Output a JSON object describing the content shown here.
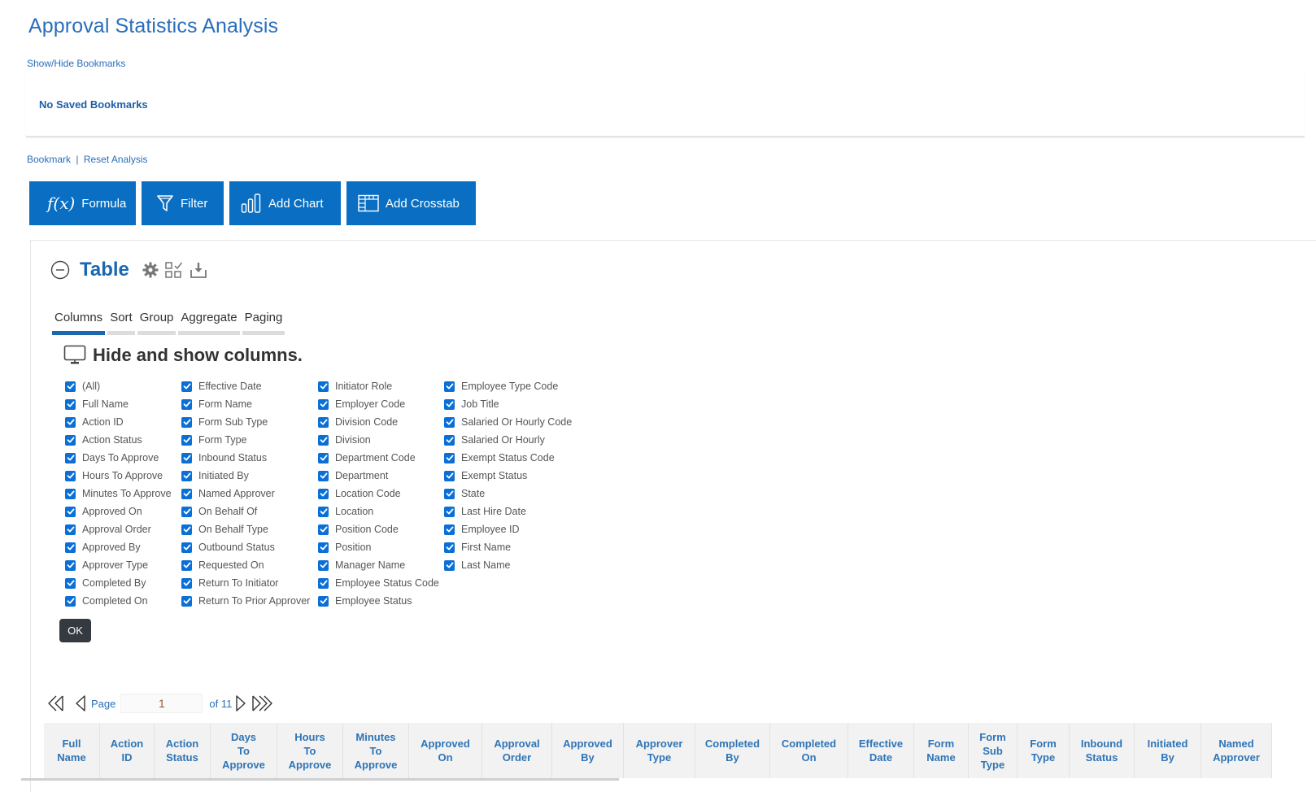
{
  "page": {
    "title": "Approval Statistics Analysis",
    "show_hide_bookmarks": "Show/Hide Bookmarks",
    "no_bookmarks": "No Saved Bookmarks",
    "bookmark_link": "Bookmark",
    "separator": "|",
    "reset_link": "Reset Analysis"
  },
  "toolbar": {
    "formula_icon": "f(x)",
    "formula": "Formula",
    "filter": "Filter",
    "add_chart": "Add Chart",
    "add_crosstab": "Add Crosstab"
  },
  "table_panel": {
    "title": "Table",
    "tabs": [
      {
        "label": "Columns",
        "active": true
      },
      {
        "label": "Sort",
        "active": false
      },
      {
        "label": "Group",
        "active": false
      },
      {
        "label": "Aggregate",
        "active": false
      },
      {
        "label": "Paging",
        "active": false
      }
    ],
    "columns_heading": "Hide and show columns.",
    "column_groups": [
      [
        "(All)",
        "Full Name",
        "Action ID",
        "Action Status",
        "Days To Approve",
        "Hours To Approve",
        "Minutes To Approve",
        "Approved On",
        "Approval Order",
        "Approved By",
        "Approver Type",
        "Completed By",
        "Completed On"
      ],
      [
        "Effective Date",
        "Form Name",
        "Form Sub Type",
        "Form Type",
        "Inbound Status",
        "Initiated By",
        "Named Approver",
        "On Behalf Of",
        "On Behalf Type",
        "Outbound Status",
        "Requested On",
        "Return To Initiator",
        "Return To Prior Approver"
      ],
      [
        "Initiator Role",
        "Employer Code",
        "Division Code",
        "Division",
        "Department Code",
        "Department",
        "Location Code",
        "Location",
        "Position Code",
        "Position",
        "Manager Name",
        "Employee Status Code",
        "Employee Status"
      ],
      [
        "Employee Type Code",
        "Job Title",
        "Salaried Or Hourly Code",
        "Salaried Or Hourly",
        "Exempt Status Code",
        "Exempt Status",
        "State",
        "Last Hire Date",
        "Employee ID",
        "First Name",
        "Last Name"
      ]
    ],
    "all_checked": true,
    "ok_label": "OK",
    "pager": {
      "page_label": "Page",
      "current_page": "1",
      "of_label": "of 11"
    },
    "grid_headers": [
      "Full Name",
      "Action ID",
      "Action Status",
      "Days To Approve",
      "Hours To Approve",
      "Minutes To Approve",
      "Approved On",
      "Approval Order",
      "Approved By",
      "Approver Type",
      "Completed By",
      "Completed On",
      "Effective Date",
      "Form Name",
      "Form Sub Type",
      "Form Type",
      "Inbound Status",
      "Initiated By",
      "Named Approver"
    ]
  },
  "colors": {
    "accent": "#0a6fc2",
    "link": "#2a6ebb",
    "header_text": "#2f74b5",
    "checkbox": "#0a6fd6",
    "ok_button": "#343a40"
  }
}
